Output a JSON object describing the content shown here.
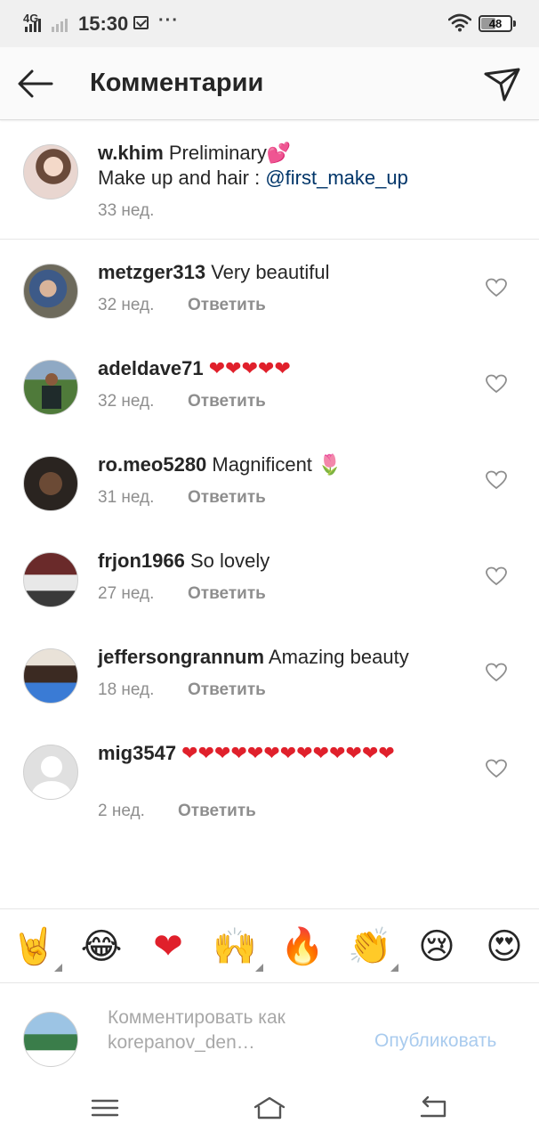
{
  "status_bar": {
    "network": "4G",
    "time": "15:30",
    "battery": "48",
    "battery_level": 0.48,
    "icons": [
      "signal-icon",
      "mail-icon",
      "more-dots-icon",
      "wifi-icon",
      "battery-icon"
    ]
  },
  "header": {
    "title": "Комментарии",
    "back_icon": "back-arrow-icon",
    "send_icon": "direct-send-icon"
  },
  "caption": {
    "username": "w.khim",
    "text": " Preliminary💕",
    "line2_prefix": "Make up and hair : ",
    "mention": "@first_make_up",
    "time": "33 нед."
  },
  "comments": [
    {
      "username": "metzger313",
      "text": " Very beautiful",
      "time": "32 нед.",
      "reply": "Ответить"
    },
    {
      "username": "adeldave71",
      "text": " ❤❤❤❤❤",
      "time": "32 нед.",
      "reply": "Ответить"
    },
    {
      "username": "ro.meo5280",
      "text": " Magnificent 🌷",
      "time": "31 нед.",
      "reply": "Ответить"
    },
    {
      "username": "frjon1966",
      "text": " So lovely",
      "time": "27 нед.",
      "reply": "Ответить"
    },
    {
      "username": "jeffersongrannum",
      "text": " Amazing beauty",
      "time": "18 нед.",
      "reply": "Ответить"
    },
    {
      "username": "mig3547",
      "text": " ❤❤❤❤❤❤❤❤❤❤❤❤❤",
      "time": "2 нед.",
      "reply": "Ответить"
    }
  ],
  "emoji_bar": [
    "🤘",
    "😂",
    "❤",
    "🙌",
    "🔥",
    "👏",
    "😢",
    "😍"
  ],
  "composer": {
    "placeholder": "Комментировать как korepanov_den…",
    "publish": "Опубликовать"
  },
  "colors": {
    "link": "#003569",
    "heart": "#e0202b",
    "muted": "#8e8e8e",
    "publish_disabled": "#a9cbee"
  }
}
